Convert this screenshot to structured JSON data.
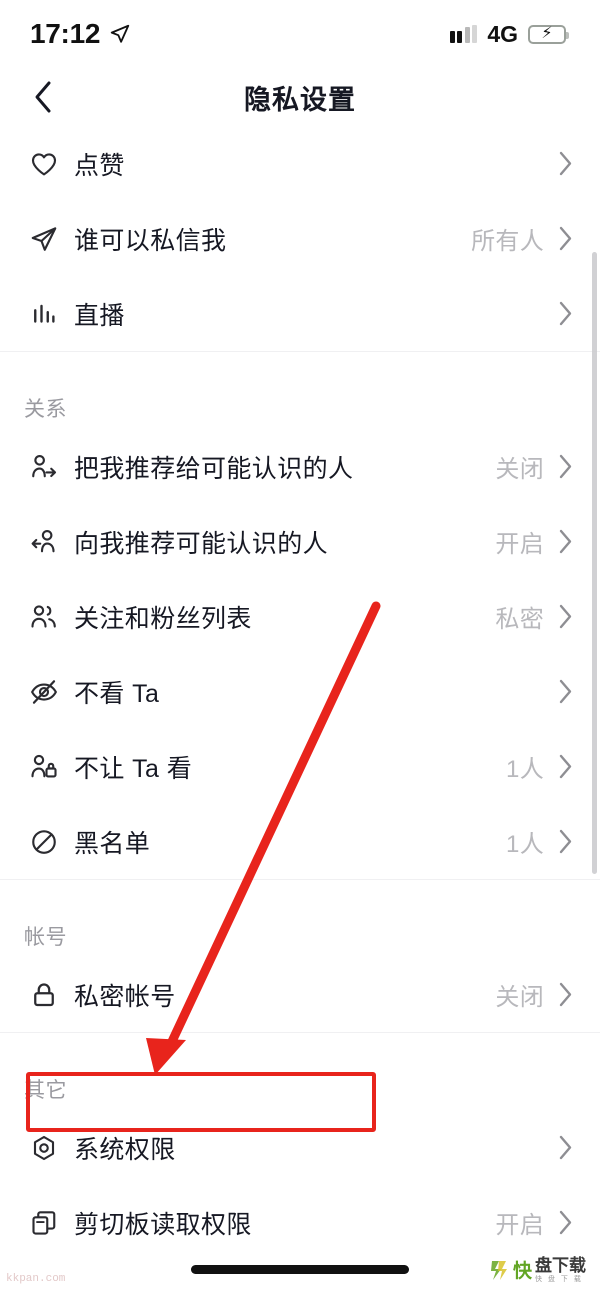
{
  "status_bar": {
    "time": "17:12",
    "location_icon": "location-arrow-icon",
    "signal_icon": "signal-dots-icon",
    "network": "4G",
    "battery_icon": "battery-charging-icon"
  },
  "nav": {
    "back_icon": "chevron-left-icon",
    "title": "隐私设置"
  },
  "list": [
    {
      "type": "row",
      "icon": "heart-icon",
      "label": "点赞",
      "value": ""
    },
    {
      "type": "row",
      "icon": "paper-plane-icon",
      "label": "谁可以私信我",
      "value": "所有人"
    },
    {
      "type": "row",
      "icon": "bar-chart-icon",
      "label": "直播",
      "value": ""
    },
    {
      "type": "section",
      "title": "关系"
    },
    {
      "type": "row",
      "icon": "person-share-icon",
      "label": "把我推荐给可能认识的人",
      "value": "关闭"
    },
    {
      "type": "row",
      "icon": "person-receive-icon",
      "label": "向我推荐可能认识的人",
      "value": "开启"
    },
    {
      "type": "row",
      "icon": "two-people-icon",
      "label": "关注和粉丝列表",
      "value": "私密"
    },
    {
      "type": "row",
      "icon": "eye-off-icon",
      "label": "不看 Ta",
      "value": ""
    },
    {
      "type": "row",
      "icon": "person-lock-icon",
      "label": "不让 Ta 看",
      "value": "1人"
    },
    {
      "type": "row",
      "icon": "block-icon",
      "label": "黑名单",
      "value": "1人"
    },
    {
      "type": "section",
      "title": "帐号"
    },
    {
      "type": "row",
      "icon": "lock-icon",
      "label": "私密帐号",
      "value": "关闭"
    },
    {
      "type": "section",
      "title": "其它"
    },
    {
      "type": "row",
      "icon": "system-permission-icon",
      "label": "系统权限",
      "value": "",
      "highlighted": true
    },
    {
      "type": "row",
      "icon": "clipboard-icon",
      "label": "剪切板读取权限",
      "value": "开启"
    }
  ],
  "annotation": {
    "box_target": "系统权限",
    "color": "#e8241c",
    "arrow_icon": "red-arrow-icon"
  },
  "watermarks": {
    "left": "kkpan.com",
    "right_logo": "kuaipan-logo-icon",
    "right_mark": "快",
    "right_text": "盘下载",
    "right_sub": "快 盘 下 载"
  },
  "home_indicator": "home-indicator-bar",
  "colors": {
    "label": "#161823",
    "value": "#b8b8bc",
    "section": "#9a9aa0",
    "accent_red": "#e8241c",
    "battery_green": "#35c759"
  }
}
